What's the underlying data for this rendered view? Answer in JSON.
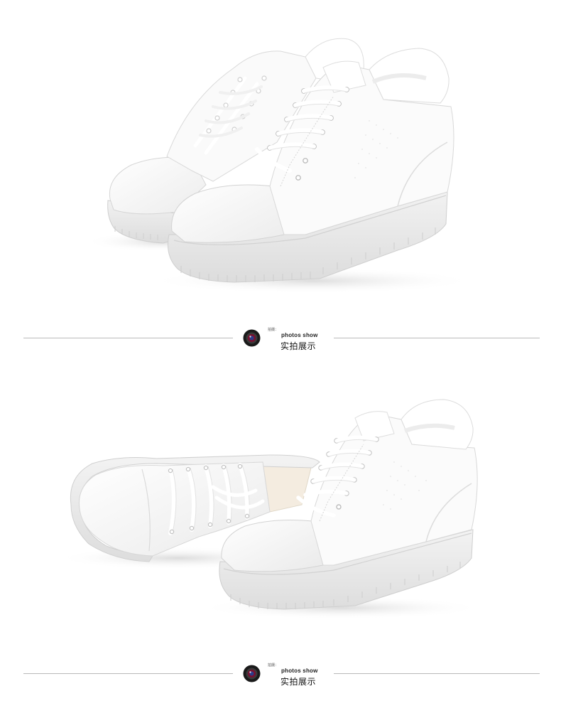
{
  "sections": [
    {
      "caption": {
        "small": "拍摄：",
        "english": "photos show",
        "chinese": "实拍展示"
      }
    },
    {
      "caption": {
        "small": "拍摄：",
        "english": "photos show",
        "chinese": "实拍展示"
      }
    }
  ],
  "colors": {
    "background": "#ffffff",
    "shoe": "#f7f7f7",
    "sole": "#e9e9e9",
    "divider": "#b9b9b9",
    "lens_dark": "#1a1a1a"
  },
  "icons": {
    "caption_icon": "camera-lens-icon"
  }
}
